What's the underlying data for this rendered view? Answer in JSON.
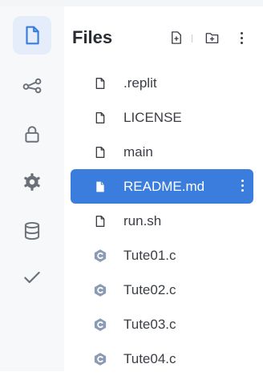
{
  "colors": {
    "accent": "#3b7ddd",
    "active_rail_bg": "#e5ecfa",
    "icon_gray": "#6b7078",
    "c_file_icon": "#8a9bb3"
  },
  "rail": {
    "items": [
      {
        "name": "files",
        "icon": "file-icon",
        "active": true
      },
      {
        "name": "version-control",
        "icon": "share-icon",
        "active": false
      },
      {
        "name": "secrets",
        "icon": "lock-icon",
        "active": false
      },
      {
        "name": "settings",
        "icon": "gear-icon",
        "active": false
      },
      {
        "name": "database",
        "icon": "database-icon",
        "active": false
      },
      {
        "name": "unit-tests",
        "icon": "checkmark-icon",
        "active": false
      }
    ]
  },
  "files_panel": {
    "title": "Files",
    "actions": [
      "add-file-icon",
      "add-folder-icon",
      "more-options-icon"
    ]
  },
  "files": [
    {
      "name": ".replit",
      "icon": "file-outline-icon",
      "selected": false
    },
    {
      "name": "LICENSE",
      "icon": "file-outline-icon",
      "selected": false
    },
    {
      "name": "main",
      "icon": "file-outline-icon",
      "selected": false
    },
    {
      "name": "README.md",
      "icon": "file-filled-icon",
      "selected": true
    },
    {
      "name": "run.sh",
      "icon": "file-outline-icon",
      "selected": false
    },
    {
      "name": "Tute01.c",
      "icon": "c-file-icon",
      "selected": false
    },
    {
      "name": "Tute02.c",
      "icon": "c-file-icon",
      "selected": false
    },
    {
      "name": "Tute03.c",
      "icon": "c-file-icon",
      "selected": false
    },
    {
      "name": "Tute04.c",
      "icon": "c-file-icon",
      "selected": false
    }
  ]
}
